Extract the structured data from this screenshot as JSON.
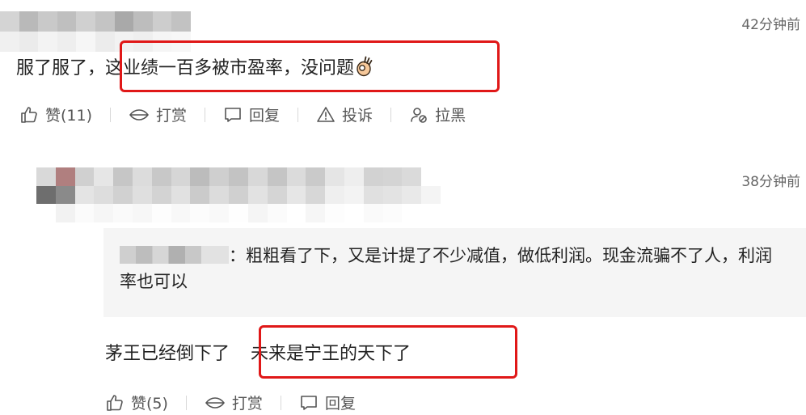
{
  "comment1": {
    "time": "42分钟前",
    "text_prefix": "服了服了，",
    "text_highlight": "这业绩一百多被市盈率，没问题",
    "emoji": "ok-hand-emoji",
    "actions": {
      "like": "赞(11)",
      "reward": "打赏",
      "reply": "回复",
      "report": "投诉",
      "block": "拉黑"
    }
  },
  "comment2": {
    "time": "38分钟前",
    "quote_sep": "：",
    "quote_text": "粗粗看了下，又是计提了不少减值，做低利润。现金流骗不了人，利润率也可以",
    "text_prefix": "茅王已经倒下了",
    "text_highlight": "未来是宁王的天下了",
    "actions": {
      "like": "赞(5)",
      "reward": "打赏",
      "reply": "回复"
    }
  },
  "colors": {
    "highlight_box": "#e01818",
    "text": "#222222",
    "muted": "#666666",
    "quote_bg": "#f5f5f5"
  }
}
